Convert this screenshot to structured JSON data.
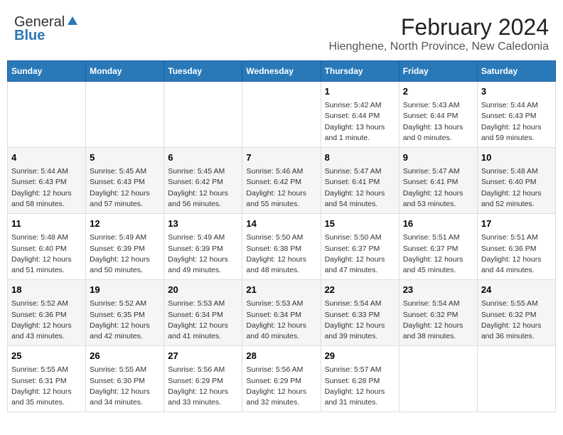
{
  "logo": {
    "general": "General",
    "blue": "Blue"
  },
  "header": {
    "title": "February 2024",
    "subtitle": "Hienghene, North Province, New Caledonia"
  },
  "weekdays": [
    "Sunday",
    "Monday",
    "Tuesday",
    "Wednesday",
    "Thursday",
    "Friday",
    "Saturday"
  ],
  "weeks": [
    [
      {
        "day": "",
        "text": ""
      },
      {
        "day": "",
        "text": ""
      },
      {
        "day": "",
        "text": ""
      },
      {
        "day": "",
        "text": ""
      },
      {
        "day": "1",
        "text": "Sunrise: 5:42 AM\nSunset: 6:44 PM\nDaylight: 13 hours and 1 minute."
      },
      {
        "day": "2",
        "text": "Sunrise: 5:43 AM\nSunset: 6:44 PM\nDaylight: 13 hours and 0 minutes."
      },
      {
        "day": "3",
        "text": "Sunrise: 5:44 AM\nSunset: 6:43 PM\nDaylight: 12 hours and 59 minutes."
      }
    ],
    [
      {
        "day": "4",
        "text": "Sunrise: 5:44 AM\nSunset: 6:43 PM\nDaylight: 12 hours and 58 minutes."
      },
      {
        "day": "5",
        "text": "Sunrise: 5:45 AM\nSunset: 6:43 PM\nDaylight: 12 hours and 57 minutes."
      },
      {
        "day": "6",
        "text": "Sunrise: 5:45 AM\nSunset: 6:42 PM\nDaylight: 12 hours and 56 minutes."
      },
      {
        "day": "7",
        "text": "Sunrise: 5:46 AM\nSunset: 6:42 PM\nDaylight: 12 hours and 55 minutes."
      },
      {
        "day": "8",
        "text": "Sunrise: 5:47 AM\nSunset: 6:41 PM\nDaylight: 12 hours and 54 minutes."
      },
      {
        "day": "9",
        "text": "Sunrise: 5:47 AM\nSunset: 6:41 PM\nDaylight: 12 hours and 53 minutes."
      },
      {
        "day": "10",
        "text": "Sunrise: 5:48 AM\nSunset: 6:40 PM\nDaylight: 12 hours and 52 minutes."
      }
    ],
    [
      {
        "day": "11",
        "text": "Sunrise: 5:48 AM\nSunset: 6:40 PM\nDaylight: 12 hours and 51 minutes."
      },
      {
        "day": "12",
        "text": "Sunrise: 5:49 AM\nSunset: 6:39 PM\nDaylight: 12 hours and 50 minutes."
      },
      {
        "day": "13",
        "text": "Sunrise: 5:49 AM\nSunset: 6:39 PM\nDaylight: 12 hours and 49 minutes."
      },
      {
        "day": "14",
        "text": "Sunrise: 5:50 AM\nSunset: 6:38 PM\nDaylight: 12 hours and 48 minutes."
      },
      {
        "day": "15",
        "text": "Sunrise: 5:50 AM\nSunset: 6:37 PM\nDaylight: 12 hours and 47 minutes."
      },
      {
        "day": "16",
        "text": "Sunrise: 5:51 AM\nSunset: 6:37 PM\nDaylight: 12 hours and 45 minutes."
      },
      {
        "day": "17",
        "text": "Sunrise: 5:51 AM\nSunset: 6:36 PM\nDaylight: 12 hours and 44 minutes."
      }
    ],
    [
      {
        "day": "18",
        "text": "Sunrise: 5:52 AM\nSunset: 6:36 PM\nDaylight: 12 hours and 43 minutes."
      },
      {
        "day": "19",
        "text": "Sunrise: 5:52 AM\nSunset: 6:35 PM\nDaylight: 12 hours and 42 minutes."
      },
      {
        "day": "20",
        "text": "Sunrise: 5:53 AM\nSunset: 6:34 PM\nDaylight: 12 hours and 41 minutes."
      },
      {
        "day": "21",
        "text": "Sunrise: 5:53 AM\nSunset: 6:34 PM\nDaylight: 12 hours and 40 minutes."
      },
      {
        "day": "22",
        "text": "Sunrise: 5:54 AM\nSunset: 6:33 PM\nDaylight: 12 hours and 39 minutes."
      },
      {
        "day": "23",
        "text": "Sunrise: 5:54 AM\nSunset: 6:32 PM\nDaylight: 12 hours and 38 minutes."
      },
      {
        "day": "24",
        "text": "Sunrise: 5:55 AM\nSunset: 6:32 PM\nDaylight: 12 hours and 36 minutes."
      }
    ],
    [
      {
        "day": "25",
        "text": "Sunrise: 5:55 AM\nSunset: 6:31 PM\nDaylight: 12 hours and 35 minutes."
      },
      {
        "day": "26",
        "text": "Sunrise: 5:55 AM\nSunset: 6:30 PM\nDaylight: 12 hours and 34 minutes."
      },
      {
        "day": "27",
        "text": "Sunrise: 5:56 AM\nSunset: 6:29 PM\nDaylight: 12 hours and 33 minutes."
      },
      {
        "day": "28",
        "text": "Sunrise: 5:56 AM\nSunset: 6:29 PM\nDaylight: 12 hours and 32 minutes."
      },
      {
        "day": "29",
        "text": "Sunrise: 5:57 AM\nSunset: 6:28 PM\nDaylight: 12 hours and 31 minutes."
      },
      {
        "day": "",
        "text": ""
      },
      {
        "day": "",
        "text": ""
      }
    ]
  ]
}
